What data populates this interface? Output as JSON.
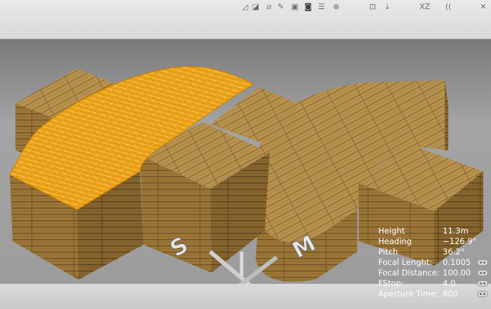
{
  "toolbar": {
    "tools": [
      {
        "name": "triangle-tool-icon",
        "glyph": "◿",
        "active": false
      },
      {
        "name": "edit-face-tool-icon",
        "glyph": "◪",
        "active": false
      },
      {
        "name": "shade-tool-icon",
        "glyph": "⧄",
        "active": false
      },
      {
        "name": "paint-tool-icon",
        "glyph": "✎",
        "active": false
      },
      {
        "name": "frame-tool-icon",
        "glyph": "▣",
        "active": false
      },
      {
        "name": "cup-tool-icon",
        "glyph": "◙",
        "active": true
      },
      {
        "name": "list-tool-icon",
        "glyph": "☰",
        "active": false
      },
      {
        "name": "close-circle-icon",
        "glyph": "⊗",
        "active": false
      },
      {
        "name": "snap-tool-icon",
        "glyph": "⊡",
        "active": false
      },
      {
        "name": "arrow-tool-icon",
        "glyph": "⤓",
        "active": false
      },
      {
        "name": "axes-xz-icon",
        "glyph": "XZ",
        "active": false
      },
      {
        "name": "brackets-icon",
        "glyph": "((",
        "active": false
      },
      {
        "name": "window-close-icon",
        "glyph": "✕",
        "active": false
      }
    ]
  },
  "camera_info": {
    "rows": [
      {
        "label": "Height",
        "value": "11.3m",
        "control": false
      },
      {
        "label": "Heading",
        "value": "−126.9°",
        "control": false
      },
      {
        "label": "Pitch",
        "value": "36.2°",
        "control": false
      },
      {
        "label": "Focal Lenght:",
        "value": "0.1005",
        "control": true
      },
      {
        "label": "Focal Distance:",
        "value": "100.00",
        "control": true
      },
      {
        "label": "FStop:",
        "value": "4.0",
        "control": true
      },
      {
        "label": "Aperture Time:",
        "value": "800",
        "control": true
      }
    ]
  },
  "colors": {
    "wood": "#b08a4a",
    "wood_dark": "#7d6030",
    "selection": "#f2a81a",
    "background": "#8d8d8d"
  },
  "gizmo": {
    "labels": [
      "S",
      "M"
    ]
  }
}
